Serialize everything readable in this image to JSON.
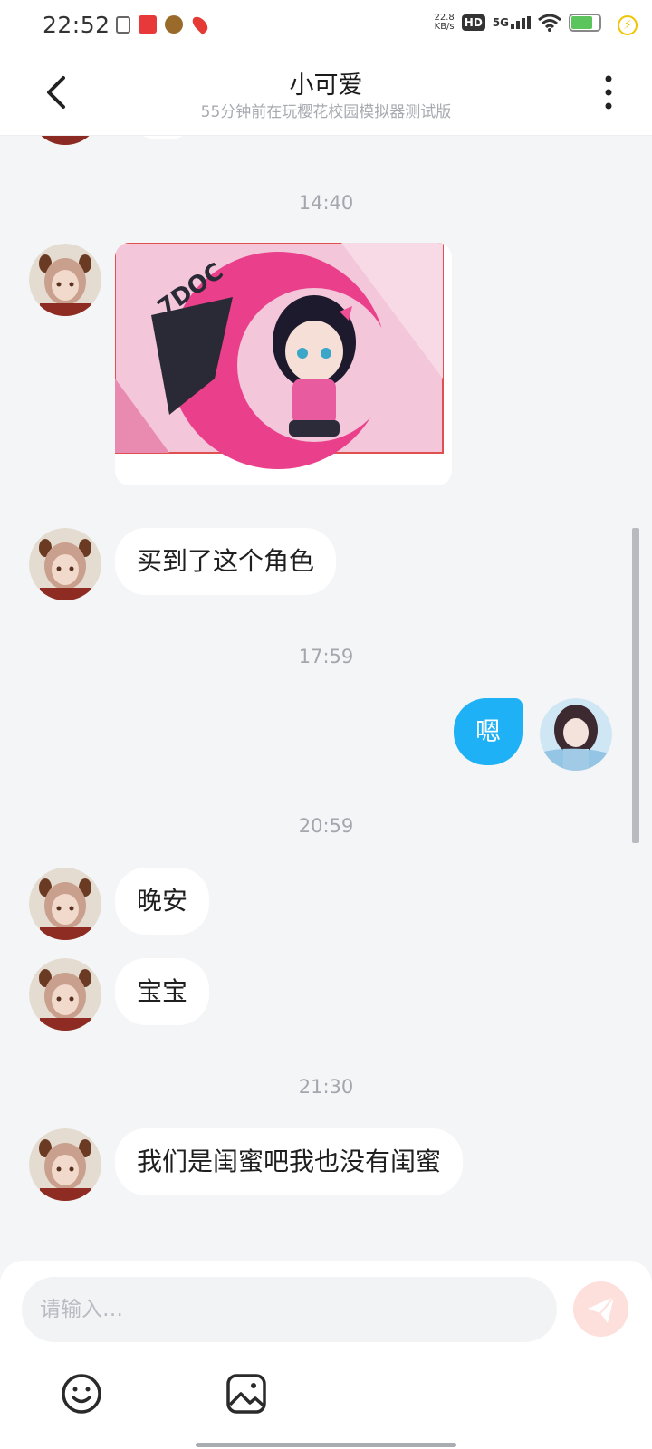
{
  "status_bar": {
    "time": "22:52",
    "net_speed_value": "22.8",
    "net_speed_unit": "KB/s",
    "hd_label": "HD",
    "network": "5G",
    "battery_level": 0.75,
    "notification_icons": [
      "document-icon",
      "red-app-icon",
      "game-app-icon",
      "map-pin-icon"
    ]
  },
  "header": {
    "title": "小可爱",
    "subtitle": "55分钟前在玩樱花校园模拟器测试版"
  },
  "messages": [
    {
      "type": "time",
      "text": "14:40"
    },
    {
      "type": "image",
      "sender": "friend",
      "image_caption": "7DOC"
    },
    {
      "type": "text",
      "sender": "friend",
      "text": "买到了这个角色"
    },
    {
      "type": "time",
      "text": "17:59"
    },
    {
      "type": "text",
      "sender": "me",
      "text": "嗯"
    },
    {
      "type": "time",
      "text": "20:59"
    },
    {
      "type": "text",
      "sender": "friend",
      "text": "晚安"
    },
    {
      "type": "text",
      "sender": "friend",
      "text": "宝宝"
    },
    {
      "type": "time",
      "text": "21:30"
    },
    {
      "type": "text",
      "sender": "friend",
      "text": "我们是闺蜜吧我也没有闺蜜"
    }
  ],
  "input": {
    "placeholder": "请输入…",
    "value": ""
  },
  "colors": {
    "my_bubble": "#1fb1f5",
    "friend_bubble": "#ffffff",
    "background": "#f4f5f7",
    "send_button_disabled": "#fde0dc"
  }
}
